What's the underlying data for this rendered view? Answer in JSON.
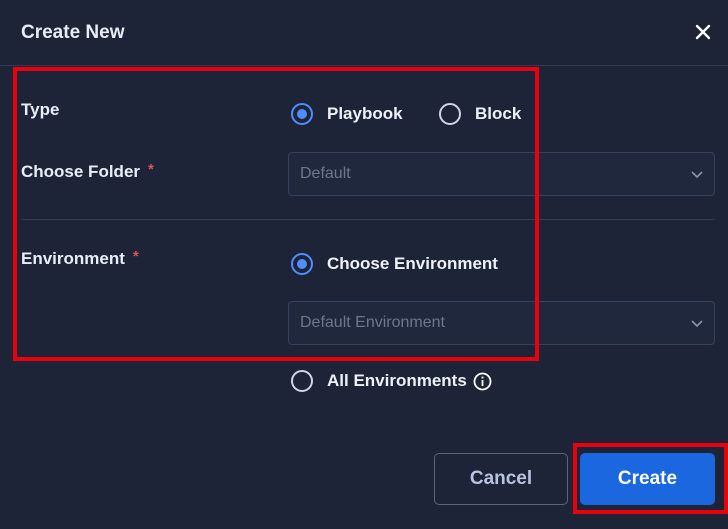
{
  "dialog": {
    "title": "Create New",
    "close_icon": "close-icon"
  },
  "form": {
    "type": {
      "label": "Type",
      "options": [
        {
          "label": "Playbook",
          "checked": true
        },
        {
          "label": "Block",
          "checked": false
        }
      ]
    },
    "folder": {
      "label": "Choose Folder",
      "required_mark": "*",
      "placeholder": "Default"
    },
    "environment": {
      "label": "Environment",
      "required_mark": "*",
      "options": [
        {
          "label": "Choose Environment",
          "checked": true
        },
        {
          "label": "All Environments",
          "checked": false
        }
      ],
      "select_placeholder": "Default Environment",
      "info_icon": "info-icon"
    }
  },
  "footer": {
    "cancel_label": "Cancel",
    "create_label": "Create"
  },
  "colors": {
    "background": "#1d2438",
    "accent": "#1a67e0",
    "radio_checked": "#4f8dff",
    "required": "#e0525c",
    "annotation": "#e8000e"
  }
}
